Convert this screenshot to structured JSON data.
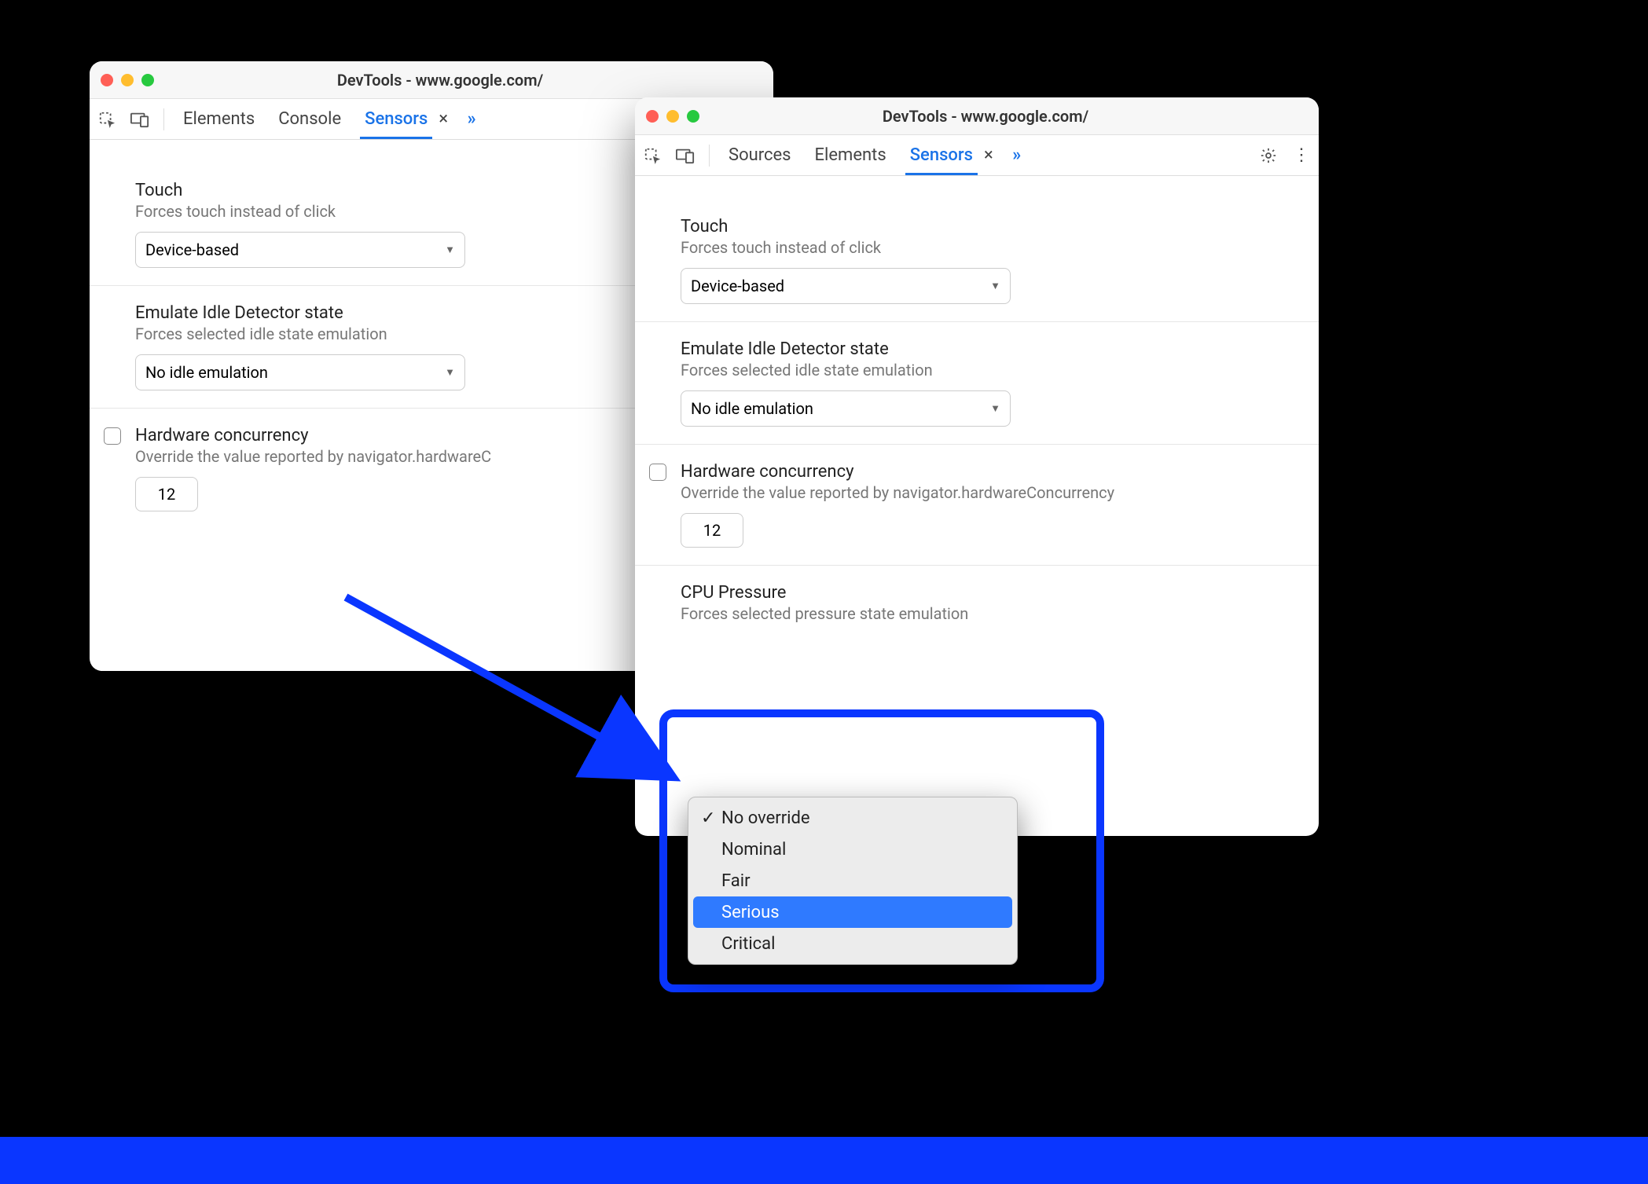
{
  "left": {
    "title": "DevTools - www.google.com/",
    "tabs": {
      "elements": "Elements",
      "console": "Console",
      "sensors": "Sensors"
    },
    "touch": {
      "title": "Touch",
      "sub": "Forces touch instead of click",
      "value": "Device-based"
    },
    "idle": {
      "title": "Emulate Idle Detector state",
      "sub": "Forces selected idle state emulation",
      "value": "No idle emulation"
    },
    "hw": {
      "title": "Hardware concurrency",
      "sub": "Override the value reported by navigator.hardwareC",
      "value": "12"
    }
  },
  "right": {
    "title": "DevTools - www.google.com/",
    "tabs": {
      "sources": "Sources",
      "elements": "Elements",
      "sensors": "Sensors"
    },
    "touch": {
      "title": "Touch",
      "sub": "Forces touch instead of click",
      "value": "Device-based"
    },
    "idle": {
      "title": "Emulate Idle Detector state",
      "sub": "Forces selected idle state emulation",
      "value": "No idle emulation"
    },
    "hw": {
      "title": "Hardware concurrency",
      "sub": "Override the value reported by navigator.hardwareConcurrency",
      "value": "12"
    },
    "cpu": {
      "title": "CPU Pressure",
      "sub": "Forces selected pressure state emulation",
      "options": {
        "no_override": "No override",
        "nominal": "Nominal",
        "fair": "Fair",
        "serious": "Serious",
        "critical": "Critical"
      }
    }
  }
}
